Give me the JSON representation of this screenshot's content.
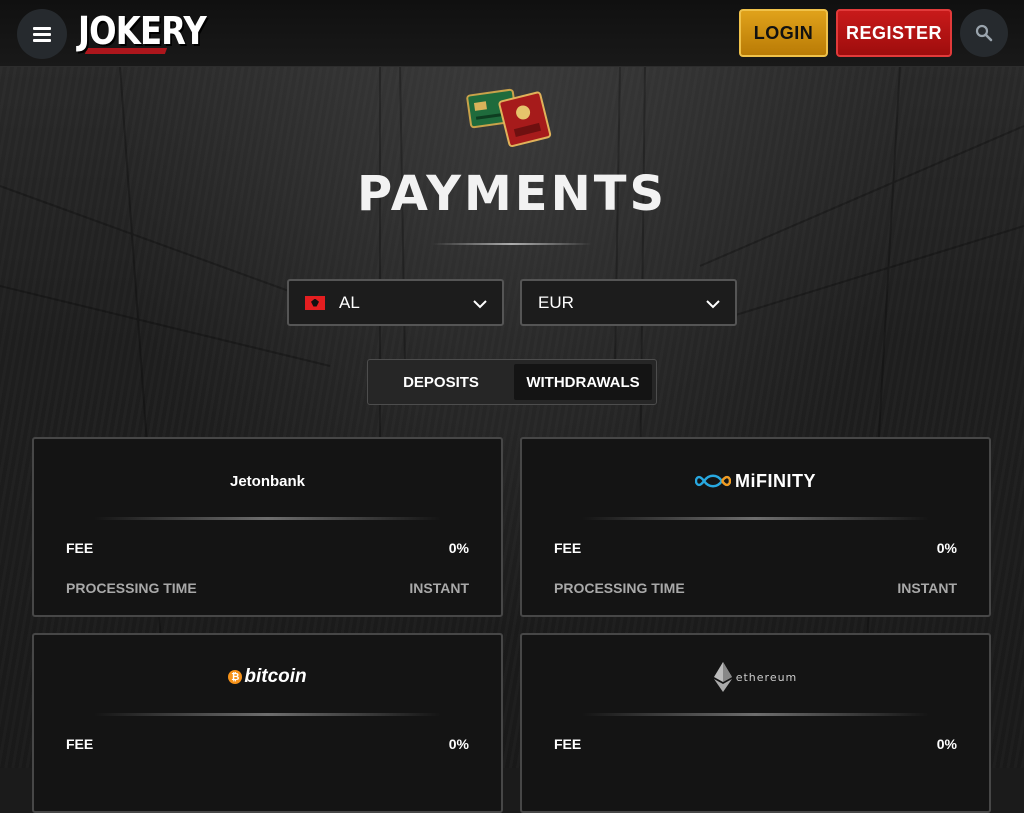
{
  "header": {
    "logo": "JOKERY",
    "login_label": "LOGIN",
    "register_label": "REGISTER",
    "icons": {
      "menu": "hamburger-menu-icon",
      "search": "search-icon"
    }
  },
  "hero": {
    "title": "PAYMENTS",
    "icon": "payment-cards-icon"
  },
  "filters": {
    "country": {
      "value": "AL",
      "flag": "albania-flag"
    },
    "currency": {
      "value": "EUR"
    }
  },
  "tabs": [
    {
      "label": "DEPOSITS",
      "active": false
    },
    {
      "label": "WITHDRAWALS",
      "active": true
    }
  ],
  "methods": [
    {
      "name": "Jetonbank",
      "fee_label": "FEE",
      "fee": "0%",
      "time_label": "PROCESSING TIME",
      "time": "INSTANT"
    },
    {
      "name": "MiFINITY",
      "fee_label": "FEE",
      "fee": "0%",
      "time_label": "PROCESSING TIME",
      "time": "INSTANT"
    },
    {
      "name": "bitcoin",
      "fee_label": "FEE",
      "fee": "0%"
    },
    {
      "name": "ethereum",
      "fee_label": "FEE",
      "fee": "0%"
    }
  ],
  "colors": {
    "login_bg": "#d99a14",
    "register_bg": "#b31414",
    "bitcoin": "#f7931a",
    "page_bg": "#1b1b1b",
    "card_bg": "#141414"
  }
}
